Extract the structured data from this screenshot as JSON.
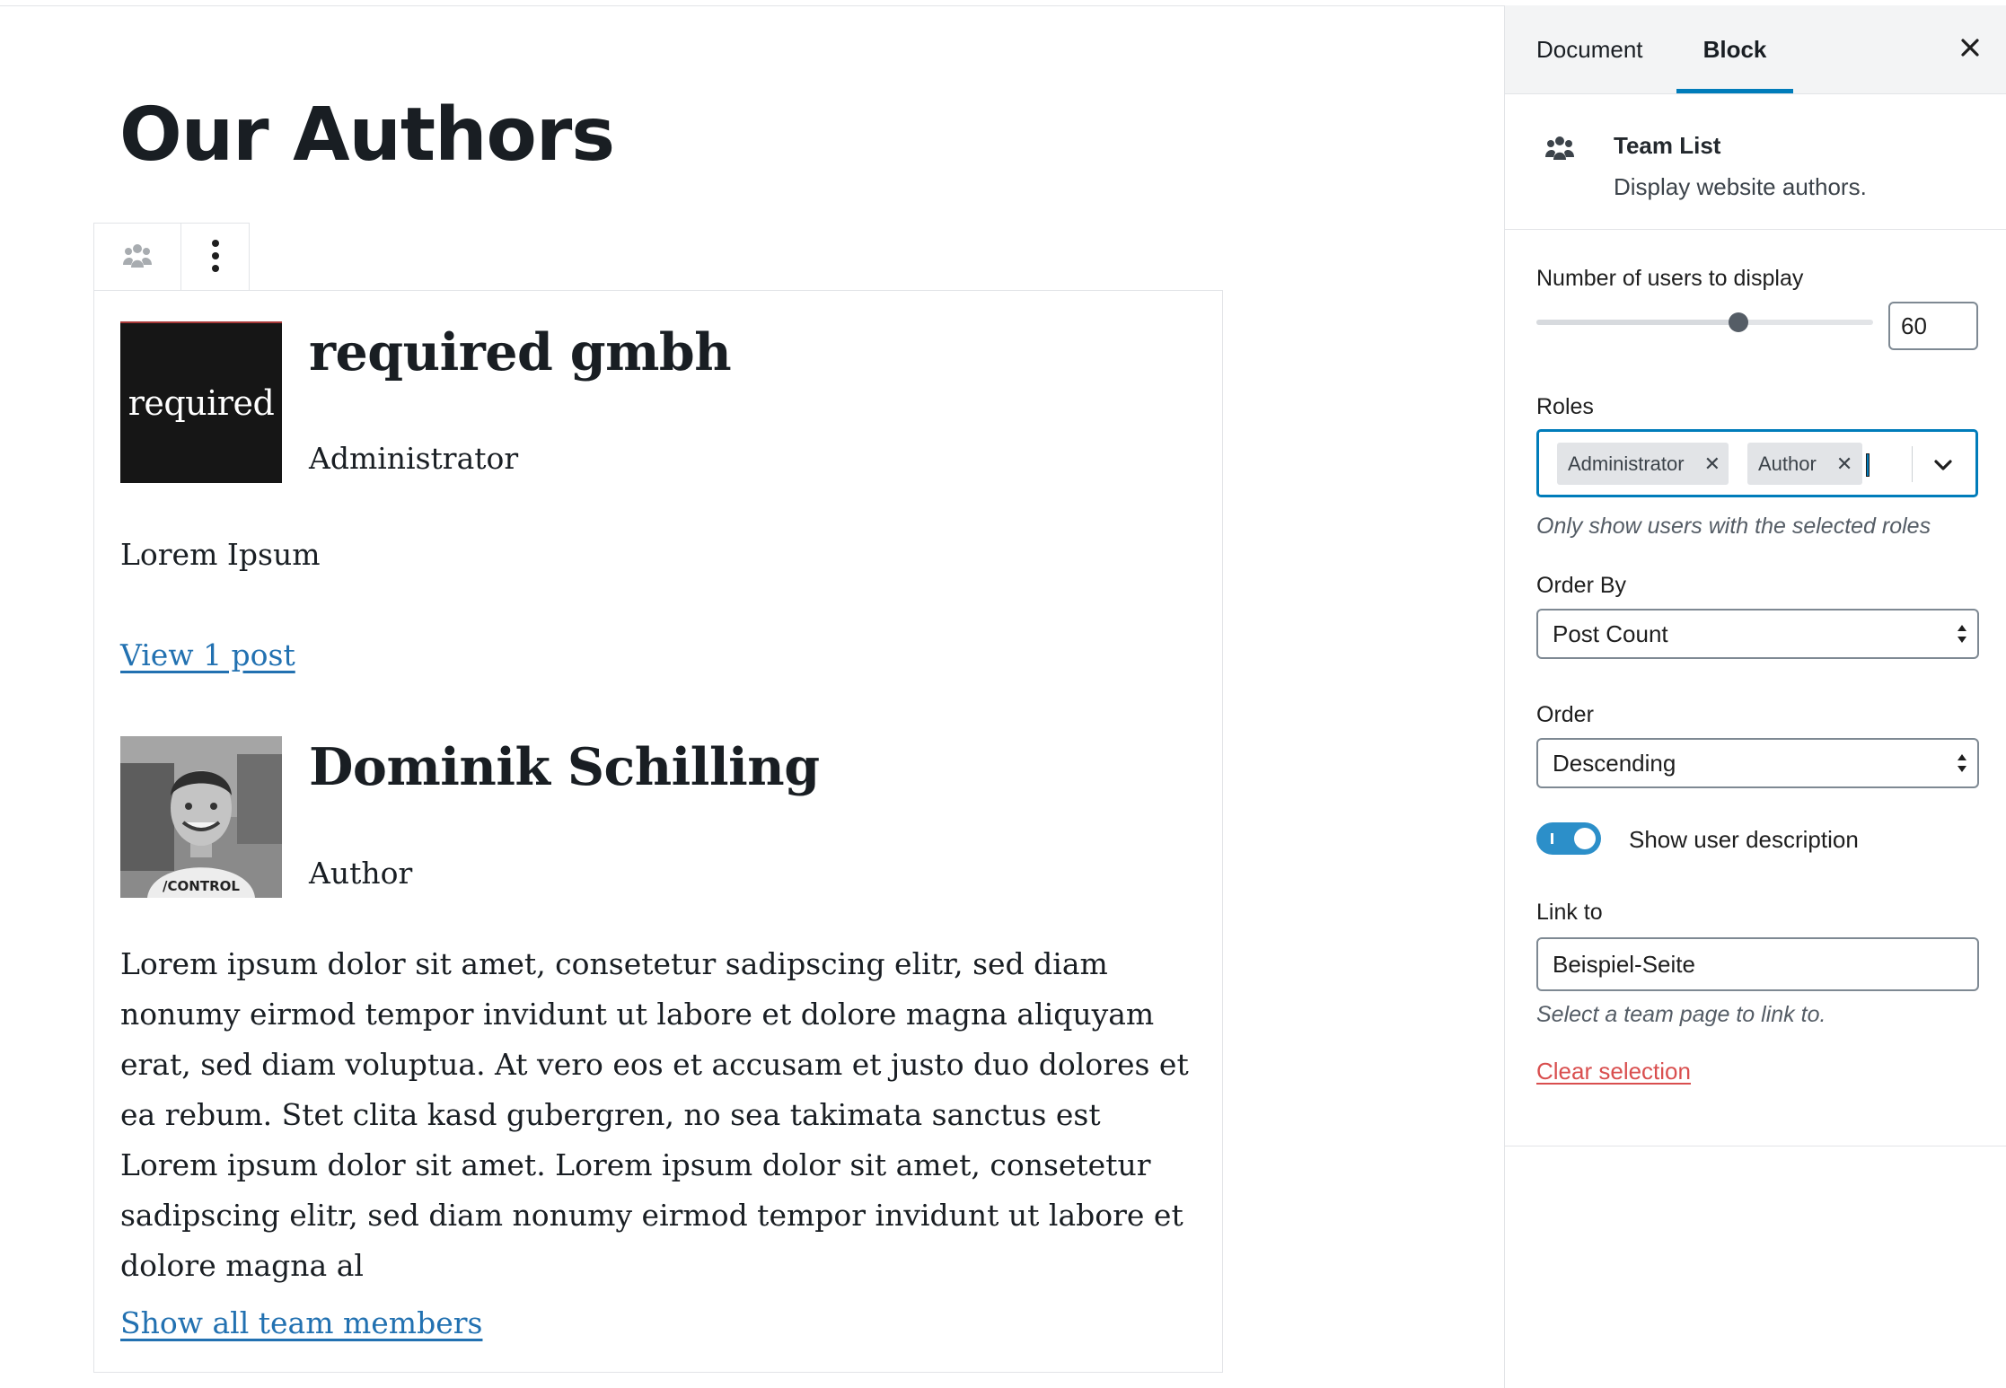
{
  "editor": {
    "page_title": "Our Authors",
    "members": [
      {
        "name": "required gmbh",
        "role": "Administrator",
        "avatar_text": "required",
        "description": "Lorem Ipsum",
        "link": "View 1 post"
      },
      {
        "name": "Dominik Schilling",
        "role": "Author",
        "description": "Lorem ipsum dolor sit amet, consetetur sadipscing elitr, sed diam nonumy eirmod tempor invidunt ut labore et dolore magna aliquyam erat, sed diam voluptua. At vero eos et accusam et justo duo dolores et ea rebum. Stet clita kasd gubergren, no sea takimata sanctus est Lorem ipsum dolor sit amet. Lorem ipsum dolor sit amet, consetetur sadipscing elitr, sed diam nonumy eirmod tempor invidunt ut labore et dolore magna al",
        "avatar_shirt_text": "/CONTROL"
      }
    ],
    "show_all_link": "Show all team members"
  },
  "sidebar": {
    "tabs": [
      "Document",
      "Block"
    ],
    "active_tab": "Block",
    "block_card": {
      "title": "Team List",
      "description": "Display website authors."
    },
    "number_label": "Number of users to display",
    "number_value": "60",
    "number_fraction": 0.6,
    "roles_label": "Roles",
    "roles": [
      "Administrator",
      "Author"
    ],
    "roles_help": "Only show users with the selected roles",
    "order_by_label": "Order By",
    "order_by_value": "Post Count",
    "order_label": "Order",
    "order_value": "Descending",
    "show_description_label": "Show user description",
    "show_description_enabled": true,
    "link_to_label": "Link to",
    "link_to_value": "Beispiel-Seite",
    "link_to_help": "Select a team page to link to.",
    "clear_selection": "Clear selection"
  },
  "colors": {
    "accent": "#007cba",
    "link": "#2271b1",
    "danger": "#d94f4f",
    "toggle_on": "#2c8fc9"
  },
  "icons": [
    "team-icon",
    "more-vertical-icon",
    "close-icon",
    "chevron-down-icon",
    "select-arrows-icon",
    "token-remove-icon"
  ]
}
